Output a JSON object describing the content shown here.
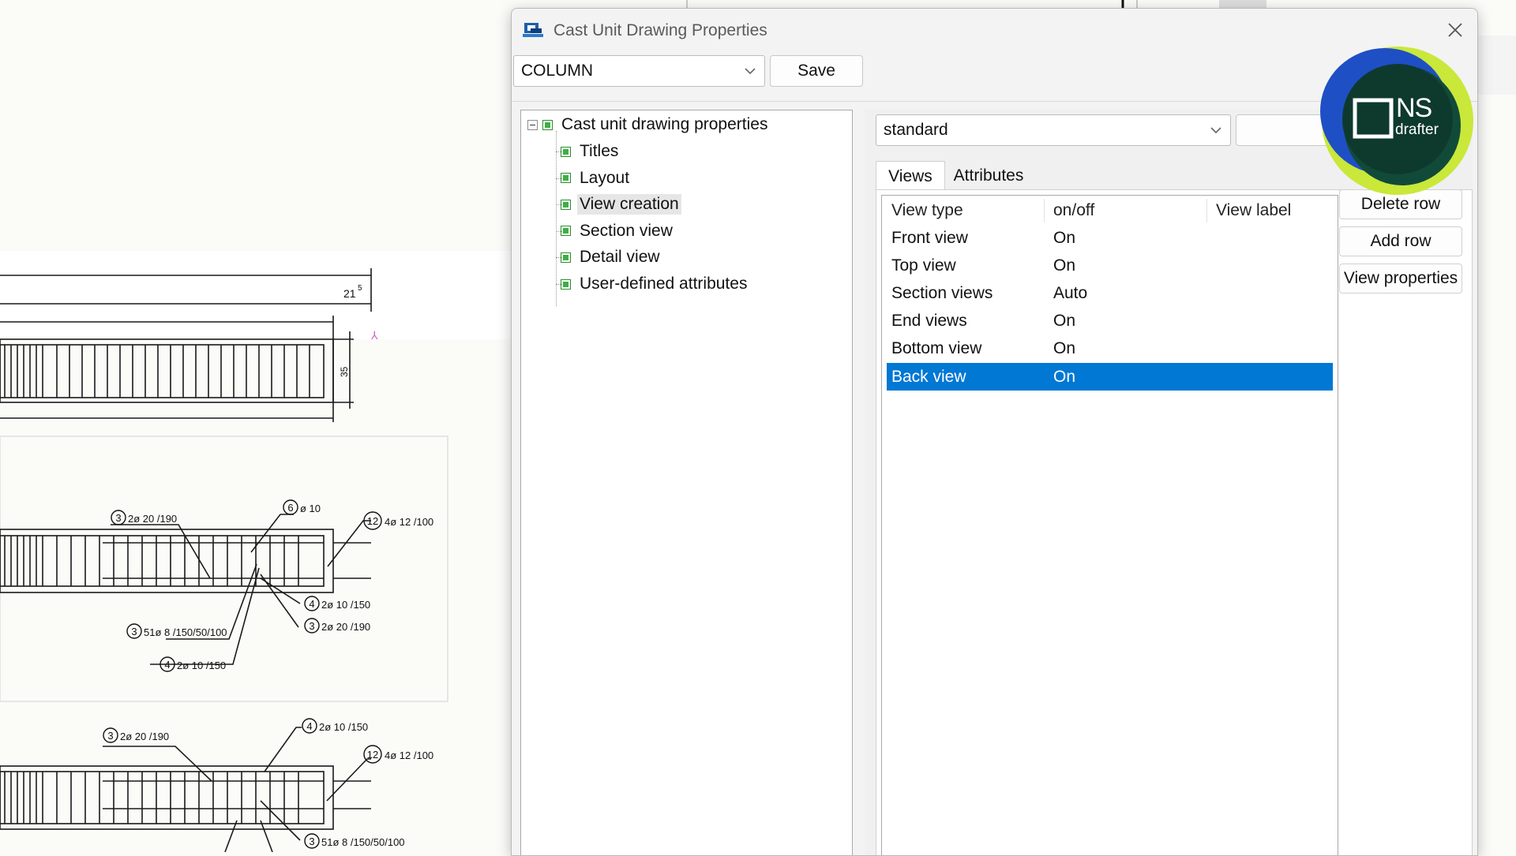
{
  "dialog": {
    "title": "Cast Unit Drawing Properties",
    "close_icon": "close-icon",
    "top_combo_value": "COLUMN",
    "save_label": "Save"
  },
  "tree": {
    "root_label": "Cast unit drawing properties",
    "items": [
      {
        "label": "Titles",
        "selected": false
      },
      {
        "label": "Layout",
        "selected": false
      },
      {
        "label": "View creation",
        "selected": true
      },
      {
        "label": "Section view",
        "selected": false
      },
      {
        "label": "Detail view",
        "selected": false
      },
      {
        "label": "User-defined attributes",
        "selected": false
      }
    ]
  },
  "settings": {
    "combo_value": "standard",
    "tabs": [
      {
        "label": "Views",
        "active": true
      },
      {
        "label": "Attributes",
        "active": false
      }
    ]
  },
  "grid": {
    "headers": [
      "View type",
      "on/off",
      "View label"
    ],
    "rows": [
      {
        "type": "Front view",
        "state": "On",
        "label": ""
      },
      {
        "type": "Top view",
        "state": "On",
        "label": ""
      },
      {
        "type": "Section views",
        "state": "Auto",
        "label": ""
      },
      {
        "type": "End views",
        "state": "On",
        "label": ""
      },
      {
        "type": "Bottom view",
        "state": "On",
        "label": ""
      },
      {
        "type": "Back view",
        "state": "On",
        "label": "",
        "selected": true
      }
    ]
  },
  "side_buttons": {
    "delete_row": "Delete row",
    "add_row": "Add row",
    "view_properties": "View properties"
  },
  "logo": {
    "main": "NS",
    "sub": "drafter",
    "colors": {
      "blue": "#1f4fc4",
      "lime": "#c9e83a",
      "dark": "#0e3a2e"
    }
  },
  "background_drawing": {
    "dimension_label": "21",
    "dimension_sup": "5",
    "dimension_side": "35",
    "labels_view1": [
      {
        "num": "3",
        "text": "2ø 20 /190"
      },
      {
        "num": "6",
        "text": "ø 10"
      },
      {
        "num": "12",
        "text": "4ø 12 /100"
      },
      {
        "num": "4",
        "text": "2ø 10 /150"
      },
      {
        "num": "3",
        "text": "2ø 20 /190"
      },
      {
        "num": "3",
        "text": "51ø 8 /150/50/100"
      },
      {
        "num": "4",
        "text": "2ø 10 /150"
      }
    ],
    "labels_view2": [
      {
        "num": "3",
        "text": "2ø 20 /190"
      },
      {
        "num": "4",
        "text": "2ø 10 /150"
      },
      {
        "num": "12",
        "text": "4ø 12 /100"
      },
      {
        "num": "3",
        "text": "51ø 8 /150/50/100"
      }
    ],
    "colors": {
      "paper": "#fbfbf8",
      "ink": "#1a1a1a"
    }
  },
  "selection_color": "#0078d4"
}
